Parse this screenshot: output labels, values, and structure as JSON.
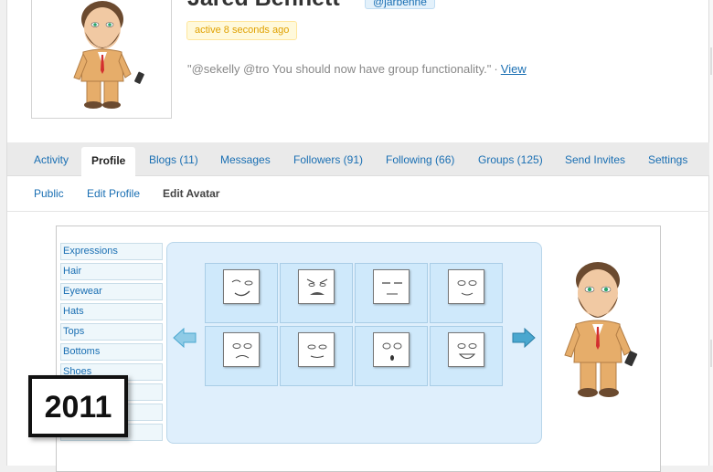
{
  "profile": {
    "name": "Jared Bennett",
    "handle": "@jarbenne",
    "active": "active 8 seconds ago",
    "status_text": "\"@sekelly @tro You should now have group functionality.\"",
    "status_sep": "·",
    "status_link": "View"
  },
  "tabs": [
    {
      "label": "Activity",
      "active": false
    },
    {
      "label": "Profile",
      "active": true
    },
    {
      "label": "Blogs (11)",
      "active": false
    },
    {
      "label": "Messages",
      "active": false
    },
    {
      "label": "Followers (91)",
      "active": false
    },
    {
      "label": "Following (66)",
      "active": false
    },
    {
      "label": "Groups (125)",
      "active": false
    },
    {
      "label": "Send Invites",
      "active": false
    },
    {
      "label": "Settings",
      "active": false
    }
  ],
  "subnav": [
    {
      "label": "Public",
      "current": false
    },
    {
      "label": "Edit Profile",
      "current": false
    },
    {
      "label": "Edit Avatar",
      "current": true
    }
  ],
  "avatar_editor": {
    "categories": [
      "Expressions",
      "Hair",
      "Eyewear",
      "Hats",
      "Tops",
      "Bottoms",
      "Shoes",
      "",
      "",
      ""
    ],
    "expressions": [
      "wink",
      "angry",
      "sleepy",
      "smile",
      "frown",
      "content",
      "surprised",
      "grin"
    ],
    "prev_icon": "arrow-left-icon",
    "next_icon": "arrow-right-icon"
  },
  "year_label": "2011",
  "colors": {
    "link": "#1a6fb3",
    "badge_bg": "#fff9db",
    "badge_text": "#e0a100",
    "panel": "#dfeffc",
    "cell": "#cfe9fb",
    "arrow": "#4aa7cf"
  }
}
